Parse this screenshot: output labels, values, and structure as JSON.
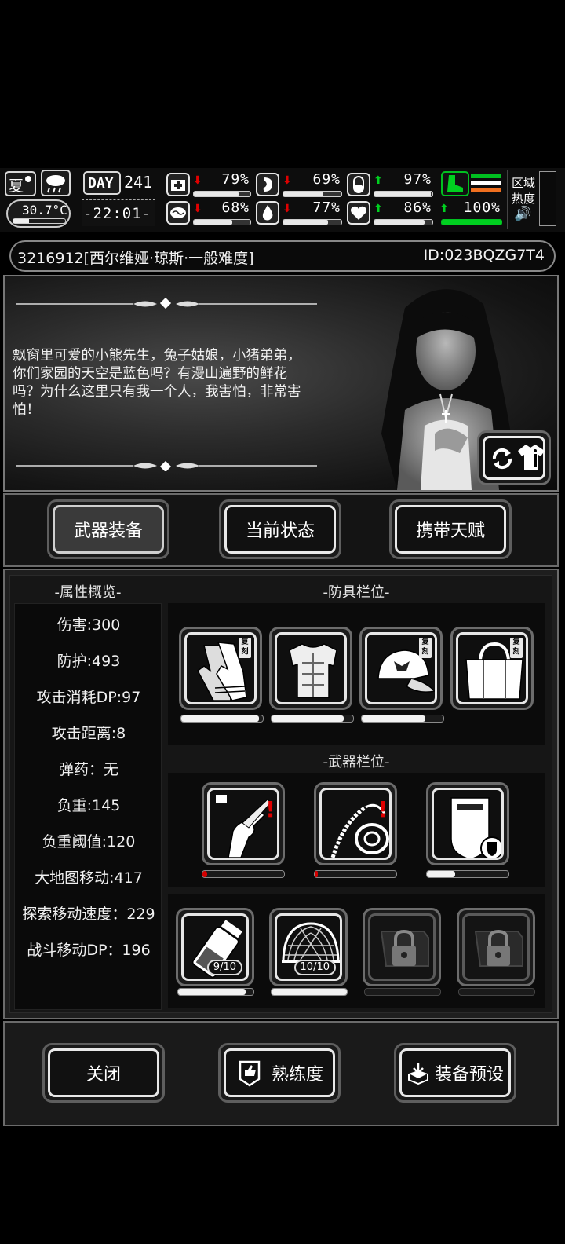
{
  "hud": {
    "season": "夏",
    "temperature": "30.7°C",
    "day_label": "DAY",
    "day_number": "241",
    "clock": "-22:01-",
    "area_heat_label_1": "区域",
    "area_heat_label_2": "热度",
    "stats": [
      {
        "icon": "medkit-icon",
        "arrow": "down",
        "value": "79%",
        "level": 0.79
      },
      {
        "icon": "stomach-icon",
        "arrow": "down",
        "value": "69%",
        "level": 0.69
      },
      {
        "icon": "pill-icon",
        "arrow": "up",
        "value": "97%",
        "level": 0.97
      },
      {
        "icon": "brain-icon",
        "arrow": "down",
        "value": "68%",
        "level": 0.68
      },
      {
        "icon": "water-drop-icon",
        "arrow": "down",
        "value": "77%",
        "level": 0.77
      },
      {
        "icon": "heart-icon",
        "arrow": "up",
        "value": "86%",
        "level": 0.86
      }
    ],
    "stamina": {
      "icon": "boot-icon",
      "arrow": "up",
      "value": "100%",
      "level": 1.0
    }
  },
  "character": {
    "name_line": "3216912[西尔维娅·琼斯·一般难度]",
    "id_line": "ID:023BQZG7T4",
    "story": "飘窗里可爱的小熊先生，兔子姑娘，小猪弟弟，你们家园的天空是蓝色吗？有漫山遍野的鲜花吗？为什么这里只有我一个人，我害怕，非常害怕！"
  },
  "tabs": {
    "weapons": "武器装备",
    "status": "当前状态",
    "talents": "携带天赋"
  },
  "attributes": {
    "title": "-属性概览-",
    "items": [
      "伤害:300",
      "防护:493",
      "攻击消耗DP:97",
      "攻击距离:8",
      "弹药：无",
      "负重:145",
      "负重阈值:120",
      "大地图移动:417",
      "探索移动速度：229",
      "战斗移动DP：196"
    ]
  },
  "armor": {
    "title": "-防具栏位-",
    "tag": "复刻",
    "slots": [
      {
        "icon": "gloves-icon",
        "durability": 0.95
      },
      {
        "icon": "body-armor-icon",
        "durability": 0.88
      },
      {
        "icon": "cap-icon",
        "durability": 0.78
      },
      {
        "icon": "bag-icon",
        "durability": 0
      }
    ]
  },
  "weapons": {
    "title": "-武器栏位-",
    "slots": [
      {
        "icon": "knife-hand-icon",
        "durability": 0.06,
        "alert": "!"
      },
      {
        "icon": "whip-icon",
        "durability": 0.04,
        "alert": "!"
      },
      {
        "icon": "riot-shield-icon",
        "durability": 0.35
      }
    ]
  },
  "items": {
    "slots": [
      {
        "icon": "flask-icon",
        "count": "9/10",
        "level": 0.9
      },
      {
        "icon": "net-icon",
        "count": "10/10",
        "level": 1.0
      },
      {
        "icon": "lock-icon",
        "locked": true
      },
      {
        "icon": "lock-icon",
        "locked": true
      }
    ]
  },
  "footer": {
    "close": "关闭",
    "proficiency": "熟练度",
    "preset": "装备预设"
  }
}
